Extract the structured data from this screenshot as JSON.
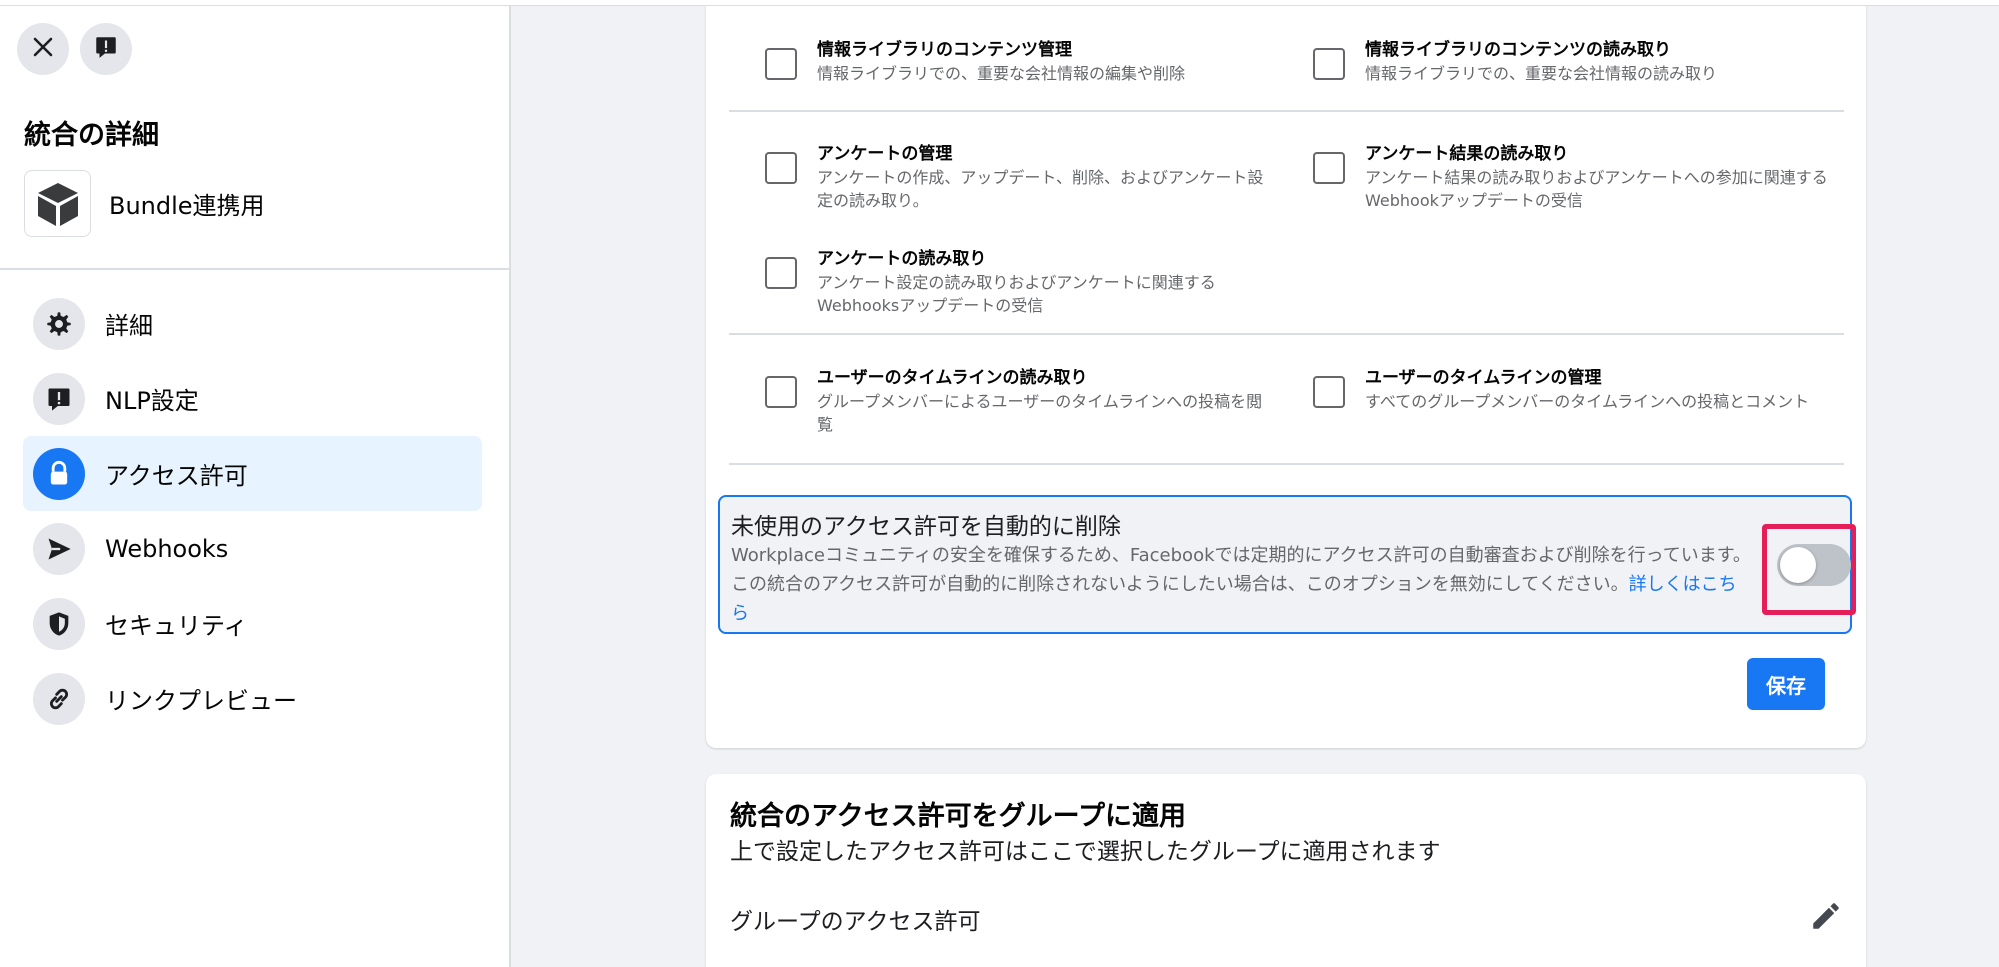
{
  "sidebar": {
    "close_icon": "close-icon",
    "report_icon": "report-icon",
    "title": "統合の詳細",
    "app_name": "Bundle連携用",
    "items": [
      {
        "label": "詳細",
        "icon": "gear-icon",
        "active": false
      },
      {
        "label": "NLP設定",
        "icon": "speech-bubble-icon",
        "active": false
      },
      {
        "label": "アクセス許可",
        "icon": "lock-icon",
        "active": true
      },
      {
        "label": "Webhooks",
        "icon": "send-icon",
        "active": false
      },
      {
        "label": "セキュリティ",
        "icon": "shield-icon",
        "active": false
      },
      {
        "label": "リンクプレビュー",
        "icon": "link-icon",
        "active": false
      }
    ]
  },
  "permissions": [
    {
      "title": "情報ライブラリのコンテンツ管理",
      "desc": "情報ライブラリでの、重要な会社情報の編集や削除",
      "checked": false
    },
    {
      "title": "情報ライブラリのコンテンツの読み取り",
      "desc": "情報ライブラリでの、重要な会社情報の読み取り",
      "checked": false
    },
    {
      "title": "アンケートの管理",
      "desc": "アンケートの作成、アップデート、削除、およびアンケート設定の読み取り。",
      "checked": false
    },
    {
      "title": "アンケート結果の読み取り",
      "desc": "アンケート結果の読み取りおよびアンケートへの参加に関連するWebhookアップデートの受信",
      "checked": false
    },
    {
      "title": "アンケートの読み取り",
      "desc": "アンケート設定の読み取りおよびアンケートに関連するWebhooksアップデートの受信",
      "checked": false
    },
    {
      "title": "ユーザーのタイムラインの読み取り",
      "desc": "グループメンバーによるユーザーのタイムラインへの投稿を閲覧",
      "checked": false
    },
    {
      "title": "ユーザーのタイムラインの管理",
      "desc": "すべてのグループメンバーのタイムラインへの投稿とコメント",
      "checked": false
    }
  ],
  "auto_remove": {
    "title": "未使用のアクセス許可を自動的に削除",
    "desc": "Workplaceコミュニティの安全を確保するため、Facebookでは定期的にアクセス許可の自動審査および削除を行っています。この統合のアクセス許可が自動的に削除されないようにしたい場合は、このオプションを無効にしてください。",
    "link": "詳しくはこちら",
    "toggle_on": false
  },
  "save_label": "保存",
  "group_section": {
    "title": "統合のアクセス許可をグループに適用",
    "subtitle": "上で設定したアクセス許可はここで選択したグループに適用されます",
    "perm_label": "グループのアクセス許可",
    "edit_icon": "pencil-icon"
  },
  "colors": {
    "accent": "#1877f2",
    "highlight": "#e41e58",
    "active_nav_bg": "#e7f3ff"
  }
}
